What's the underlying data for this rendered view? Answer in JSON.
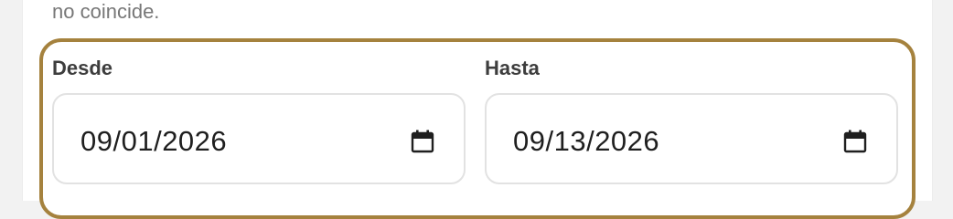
{
  "help_text": "no coincide.",
  "date_range": {
    "from": {
      "label": "Desde",
      "value": "09/01/2026",
      "icon": "calendar-icon"
    },
    "to": {
      "label": "Hasta",
      "value": "09/13/2026",
      "icon": "calendar-icon"
    }
  },
  "colors": {
    "focus_border": "#a5823e",
    "field_border": "#e2e2e2",
    "label_text": "#3d3d3d",
    "help_text": "#777777"
  }
}
